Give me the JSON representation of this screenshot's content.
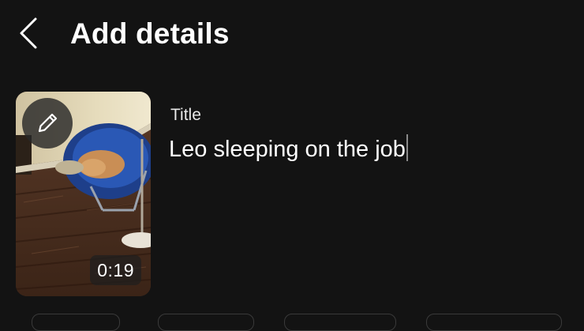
{
  "header": {
    "back_icon": "chevron-left-icon",
    "title": "Add details"
  },
  "video": {
    "edit_icon": "pencil-icon",
    "duration": "0:19"
  },
  "form": {
    "title_label": "Title",
    "title_value": "Leo sleeping on the job"
  },
  "colors": {
    "background": "#131313",
    "text": "#ffffff",
    "caret": "#8a8a8a"
  }
}
